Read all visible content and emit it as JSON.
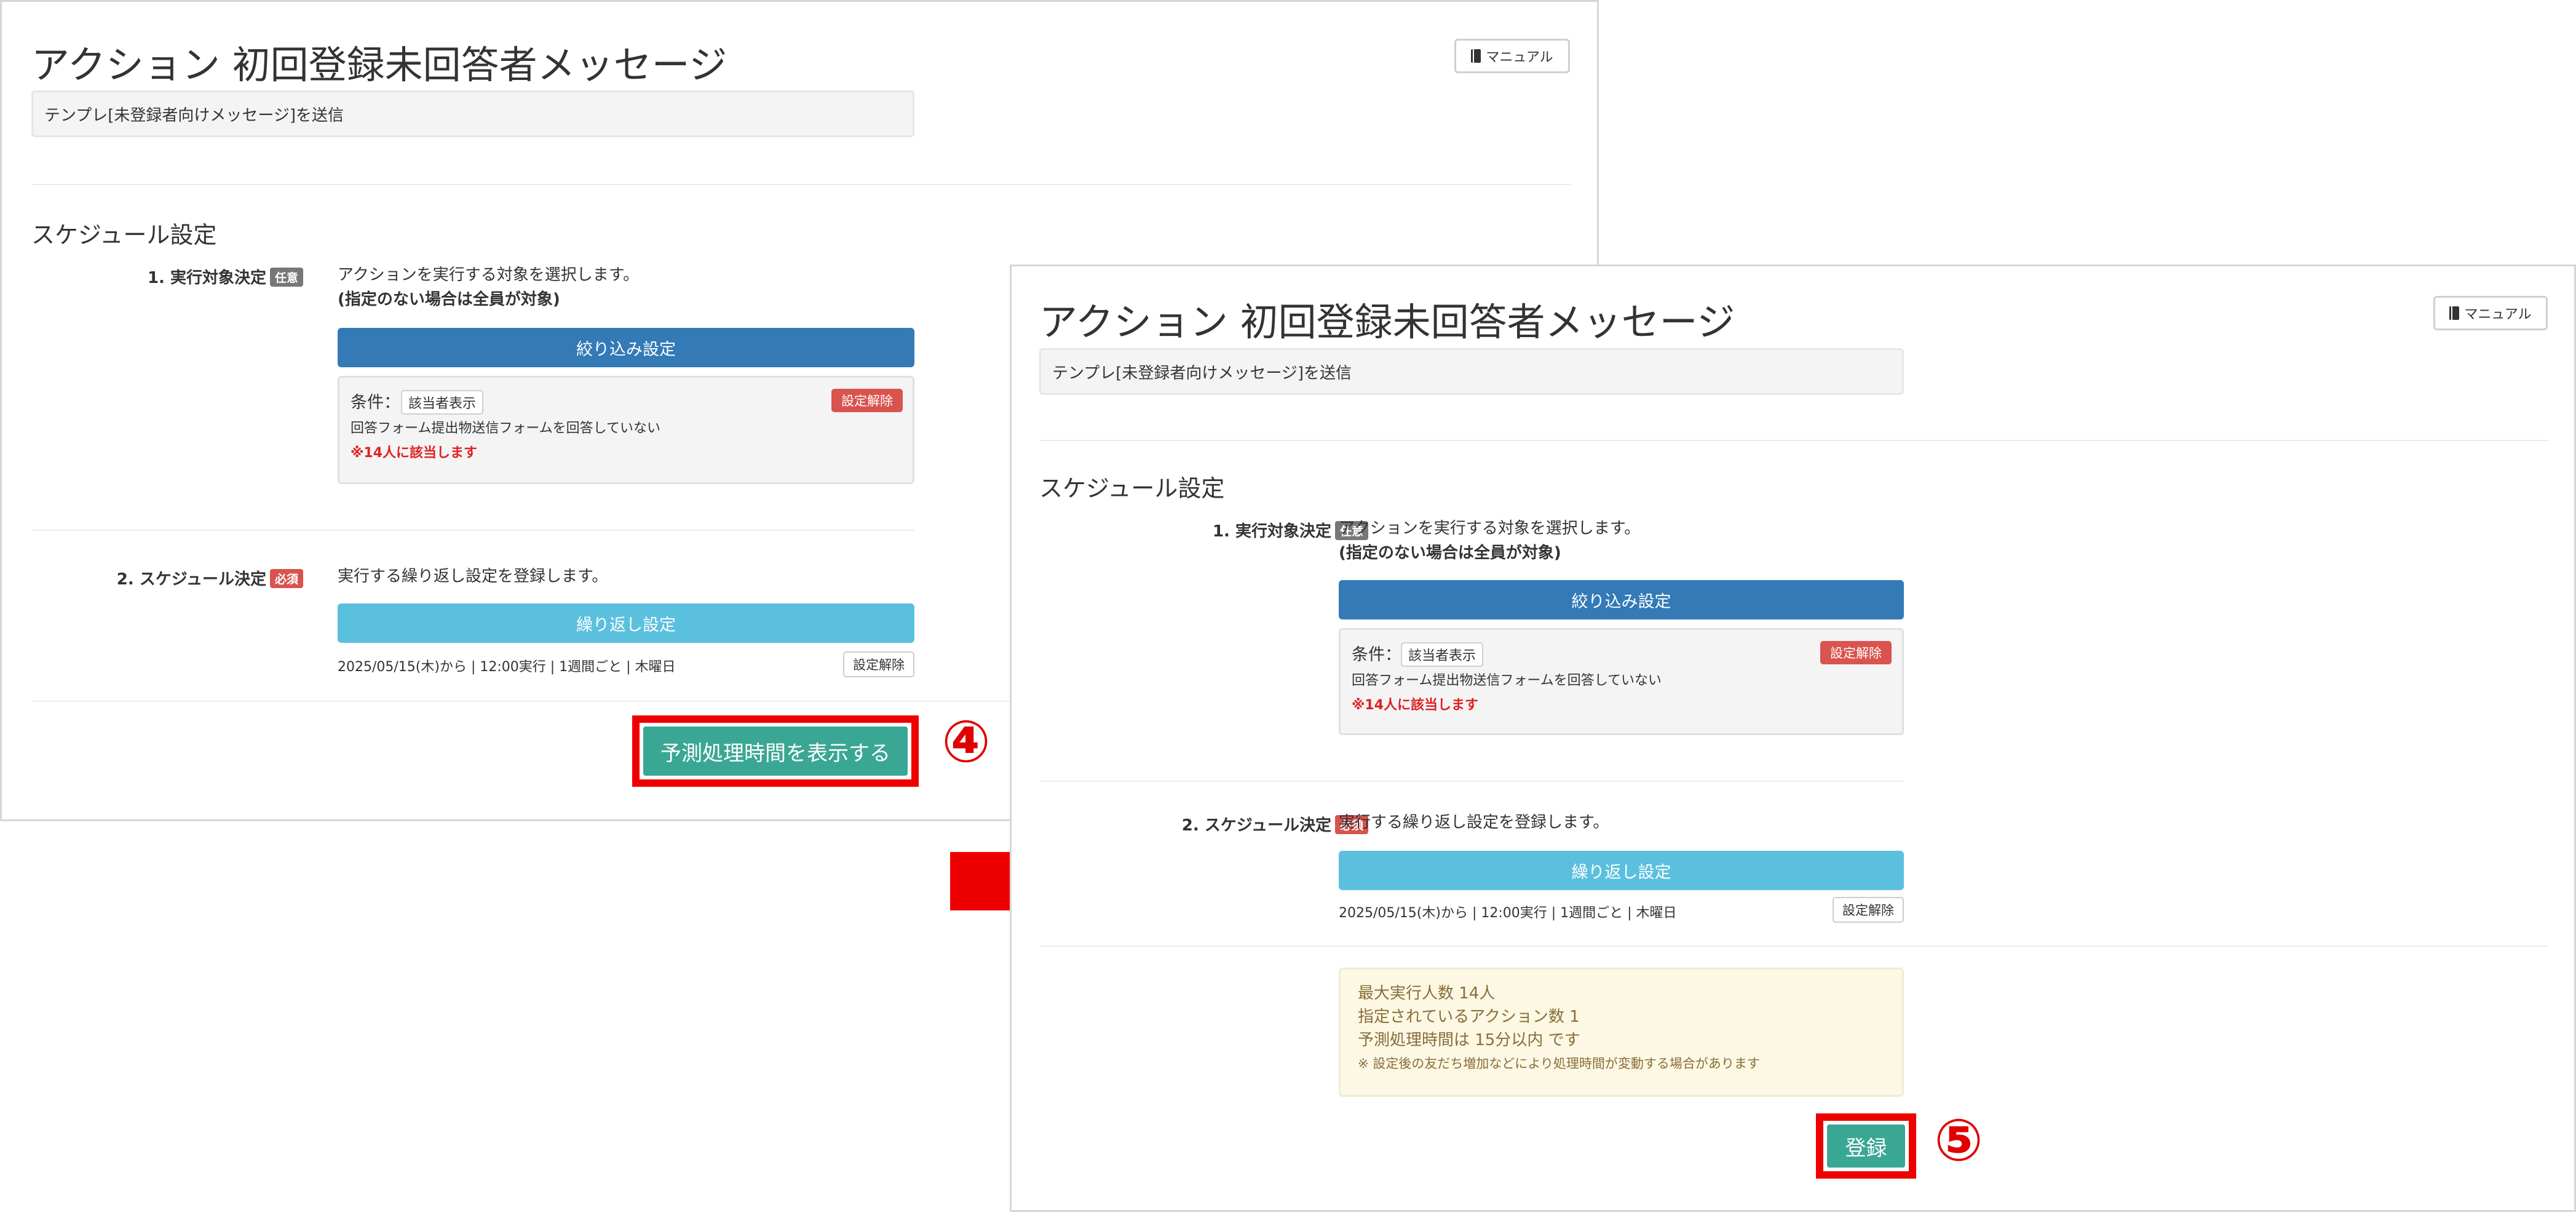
{
  "page": {
    "title": "アクション 初回登録未回答者メッセージ",
    "manual_label": "マニュアル",
    "description": "テンプレ[未登録者向けメッセージ]を送信",
    "section_title": "スケジュール設定",
    "step1": {
      "label": "1. 実行対象決定",
      "tag": "任意",
      "text_line1": "アクションを実行する対象を選択します。",
      "text_line2": "(指定のない場合は全員が対象)",
      "filter_button": "絞り込み設定",
      "condition_label": "条件：",
      "condition_chip": "該当者表示",
      "clear_button": "設定解除",
      "condition_detail": "回答フォーム提出物送信フォームを回答していない",
      "match_count": "※14人に該当します"
    },
    "step2": {
      "label": "2. スケジュール決定",
      "tag": "必須",
      "text": "実行する繰り返し設定を登録します。",
      "repeat_button": "繰り返し設定",
      "schedule_summary": "2025/05/15(木)から | 12:00実行 | 1週間ごと | 木曜日",
      "clear_button": "設定解除"
    }
  },
  "before": {
    "show_time_button": "予測処理時間を表示する",
    "step_number": "④"
  },
  "after": {
    "estimate": {
      "max_people": "最大実行人数 14人",
      "action_count": "指定されているアクション数 1",
      "estimated_time": "予測処理時間は 15分以内 です",
      "note": "※ 設定後の友だち増加などにより処理時間が変動する場合があります"
    },
    "register_button": "登録",
    "step_number": "⑤"
  },
  "colors": {
    "primary_blue": "#337ab7",
    "info_cyan": "#5bc0de",
    "danger_red": "#d9534f",
    "success_green": "#3aa794",
    "highlight_red": "#ee0000",
    "warning_bg": "#fcf8e3"
  },
  "icons": {
    "manual": "book-icon",
    "transition": "arrow-right-icon"
  }
}
